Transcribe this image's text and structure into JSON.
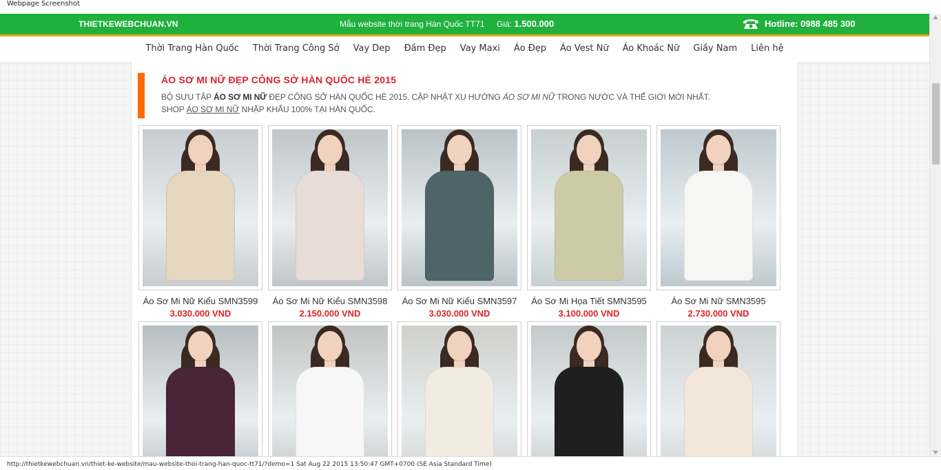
{
  "window": {
    "title": "Webpage Screenshot"
  },
  "topbar": {
    "brand": "THIETKEWEBCHUAN.VN",
    "template_name": "Mẫu website thời trang Hàn Quốc TT71",
    "price_label": "Giá:",
    "price_value": "1.500.000",
    "hotline": "Hotline: 0988 485 300",
    "bg_color": "#1fb03e",
    "icon": "phone-icon"
  },
  "nav": {
    "items": [
      {
        "label": "Thời Trang Hàn Quốc"
      },
      {
        "label": "Thời Trang Công Sở"
      },
      {
        "label": "Vay Dep"
      },
      {
        "label": "Đầm Đẹp"
      },
      {
        "label": "Vay Maxi"
      },
      {
        "label": "Áo Đẹp"
      },
      {
        "label": "Áo Vest Nữ"
      },
      {
        "label": "Áo Khoác Nữ"
      },
      {
        "label": "Giầy Nam"
      },
      {
        "label": "Liên hệ"
      }
    ]
  },
  "intro": {
    "title": "ÁO SƠ MI NỮ ĐẸP CÔNG SỞ HÀN QUỐC HÈ 2015",
    "line1_a": "BỘ SƯU TẬP ",
    "line1_b": "ÁO SƠ MI NỮ",
    "line1_c": " ĐẸP CÔNG SỞ HÀN QUỐC HÈ 2015. CẬP NHẬT XU HƯỚNG ",
    "line1_d": "ÁO SƠ MI NỮ",
    "line1_e": " TRONG NƯỚC VÀ THẾ GIỚI MỚI NHẤT.",
    "line2_a": "SHOP ",
    "line2_b": "ÁO SƠ MI NỮ",
    "line2_c": " NHẬP KHẨU 100% TẠI HÀN QUỐC.",
    "accent_color": "#ff6b00"
  },
  "products": [
    {
      "name": "Áo Sơ Mi Nữ Kiểu SMN3599",
      "price": "3.030.000 VND",
      "color": "#e4d6bf",
      "bg": "#c6ccd0"
    },
    {
      "name": "Áo Sơ Mi Nữ Kiểu SMN3598",
      "price": "2.150.000 VND",
      "color": "#e8dcd6",
      "bg": "#bfc6c9"
    },
    {
      "name": "Áo Sơ Mi Nữ Kiểu SMN3597",
      "price": "3.030.000 VND",
      "color": "#4d6468",
      "bg": "#b9c3c6"
    },
    {
      "name": "Áo Sơ Mi Họa Tiết SMN3595",
      "price": "3.100.000 VND",
      "color": "#cdcba6",
      "bg": "#c7cfcf"
    },
    {
      "name": "Áo Sơ Mi Nữ SMN3595",
      "price": "2.730.000 VND",
      "color": "#f6f6f4",
      "bg": "#bec9cf"
    },
    {
      "name": "",
      "price": "",
      "color": "#4a2438",
      "bg": "#b7bec2"
    },
    {
      "name": "",
      "price": "",
      "color": "#f7f7f7",
      "bg": "#c1c4c2"
    },
    {
      "name": "",
      "price": "",
      "color": "#f1ebe2",
      "bg": "#cfd0cc"
    },
    {
      "name": "",
      "price": "",
      "color": "#1f1f1f",
      "bg": "#c4c9ca"
    },
    {
      "name": "",
      "price": "",
      "color": "#f3e6da",
      "bg": "#cdd2d3"
    }
  ],
  "status": {
    "text": "http://thietkewebchuan.vn/thiet-ke-website/mau-website-thoi-trang-han-quoc-tt71/?demo=1 Sat Aug 22 2015 13:50:47 GMT+0700 (SE Asia Standard Time)"
  }
}
